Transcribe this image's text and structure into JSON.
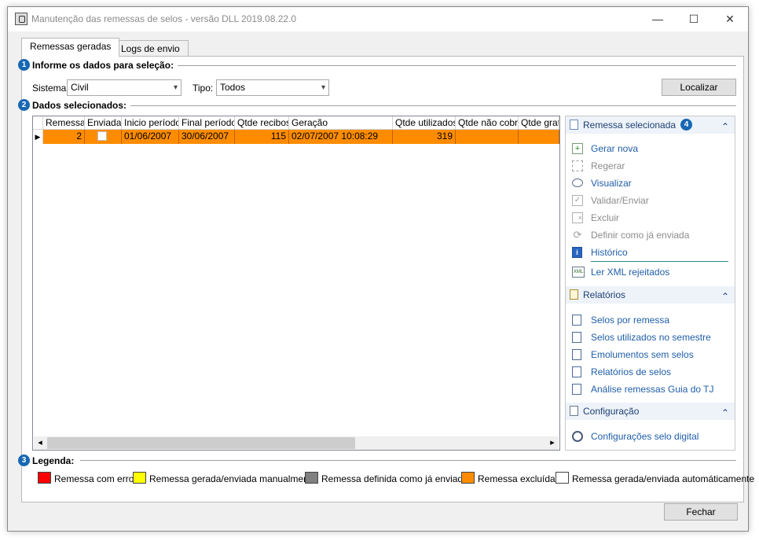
{
  "window": {
    "title": "Manutenção das remessas de selos - versão DLL 2019.08.22.0",
    "minimize": "—",
    "maximize": "☐",
    "close": "✕"
  },
  "tabs": [
    {
      "label": "Remessas geradas",
      "active": true
    },
    {
      "label": "Logs de envio",
      "active": false
    }
  ],
  "filters": {
    "step": "1",
    "heading": "Informe os dados para seleção:",
    "sistema_label": "Sistema:",
    "sistema_value": "Civil",
    "tipo_label": "Tipo:",
    "tipo_value": "Todos",
    "localizar": "Localizar"
  },
  "data_section": {
    "step": "2",
    "heading": "Dados selecionados:"
  },
  "grid": {
    "columns": [
      "Remessa",
      "Enviada",
      "Inicio período",
      "Final período",
      "Qtde recibos",
      "Geração",
      "Qtde utilizados",
      "Qtde não cobra",
      "Qtde gratu"
    ],
    "rows": [
      {
        "remessa": "2",
        "enviada": "",
        "inicio": "01/06/2007",
        "final": "30/06/2007",
        "recibos": "115",
        "geracao": "02/07/2007 10:08:29",
        "utilizados": "319",
        "nao_cobra": "",
        "gratu": ""
      }
    ],
    "row_color": "#ff8c00",
    "scroll_left": "◂",
    "scroll_right": "▸"
  },
  "taskpane": {
    "step": "4",
    "remessa": {
      "title": "Remessa selecionada",
      "items": [
        {
          "label": "Gerar nova",
          "enabled": true
        },
        {
          "label": "Regerar",
          "enabled": false
        },
        {
          "label": "Visualizar",
          "enabled": true
        },
        {
          "label": "Validar/Enviar",
          "enabled": false
        },
        {
          "label": "Excluir",
          "enabled": false
        },
        {
          "label": "Definir como já enviada",
          "enabled": false
        },
        {
          "label": "Histórico",
          "enabled": true
        },
        {
          "label": "Ler XML rejeitados",
          "enabled": true
        }
      ]
    },
    "relatorios": {
      "title": "Relatórios",
      "items": [
        {
          "label": "Selos por remessa"
        },
        {
          "label": "Selos utilizados no semestre"
        },
        {
          "label": "Emolumentos sem selos"
        },
        {
          "label": "Relatórios de selos"
        },
        {
          "label": "Análise remessas Guia do TJ"
        }
      ]
    },
    "configuracao": {
      "title": "Configuração",
      "items": [
        {
          "label": "Configurações selo digital"
        }
      ]
    },
    "collapse_glyph": "⌃"
  },
  "legend": {
    "step": "3",
    "heading": "Legenda:",
    "items": [
      {
        "label": "Remessa com erro",
        "color": "#ff0000"
      },
      {
        "label": "Remessa gerada/enviada manualmente",
        "color": "#ffff00"
      },
      {
        "label": "Remessa definida como já enviada",
        "color": "#808080"
      },
      {
        "label": "Remessa excluída",
        "color": "#ff8c00"
      },
      {
        "label": "Remessa gerada/enviada automáticamente",
        "color": "#ffffff"
      }
    ]
  },
  "footer": {
    "fechar": "Fechar"
  }
}
